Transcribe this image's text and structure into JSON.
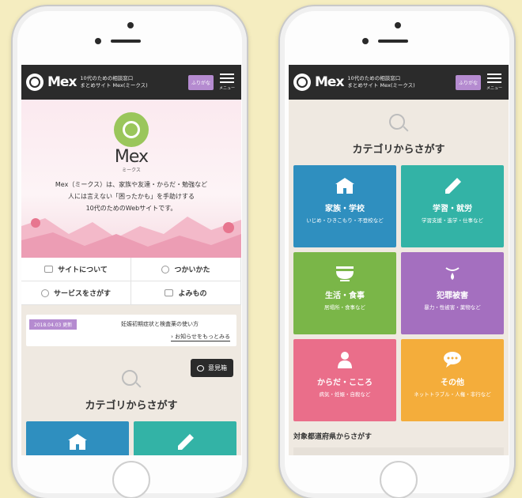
{
  "header": {
    "logo": "Mex",
    "tagline_line1": "10代のための相談窓口",
    "tagline_line2": "まとめサイト Mex(ミークス)",
    "furigana_button": "ふりがな",
    "menu_label": "メニュー"
  },
  "hero": {
    "name": "Mex",
    "kana": "ミークス",
    "line1": "Mex（ミークス）は、家族や友達・からだ・勉強など",
    "line2": "人には言えない「困ったかも」を手助けする",
    "line3": "10代のためのWebサイトです。"
  },
  "nav": [
    {
      "label": "サイトについて"
    },
    {
      "label": "つかいかた"
    },
    {
      "label": "サービスをさがす"
    },
    {
      "label": "よみもの"
    }
  ],
  "news": {
    "date": "2018.04.03 更新",
    "title": "妊娠初期症状と検査薬の使い方",
    "more": "› お知らせをもっとみる"
  },
  "opinion_button": "意見箱",
  "category_title": "カテゴリからさがす",
  "categories": [
    {
      "name": "家族・学校",
      "sub": "いじめ・ひきこもり・不登校など",
      "color": "#2f8fbf",
      "icon": "school-icon"
    },
    {
      "name": "学習・就労",
      "sub": "学習支援・進学・仕事など",
      "color": "#33b3a6",
      "icon": "pencil-icon"
    },
    {
      "name": "生活・食事",
      "sub": "居場所・食事など",
      "color": "#7ab648",
      "icon": "bowl-icon"
    },
    {
      "name": "犯罪被害",
      "sub": "暴力・性被害・薬物など",
      "color": "#a46fbf",
      "icon": "tear-icon"
    },
    {
      "name": "からだ・こころ",
      "sub": "病気・妊娠・自殺など",
      "color": "#ea6e8a",
      "icon": "person-icon"
    },
    {
      "name": "その他",
      "sub": "ネットトラブル・人権・非行など",
      "color": "#f4ad3b",
      "icon": "chat-icon"
    }
  ],
  "prefecture_title": "対象都道府県からさがす"
}
